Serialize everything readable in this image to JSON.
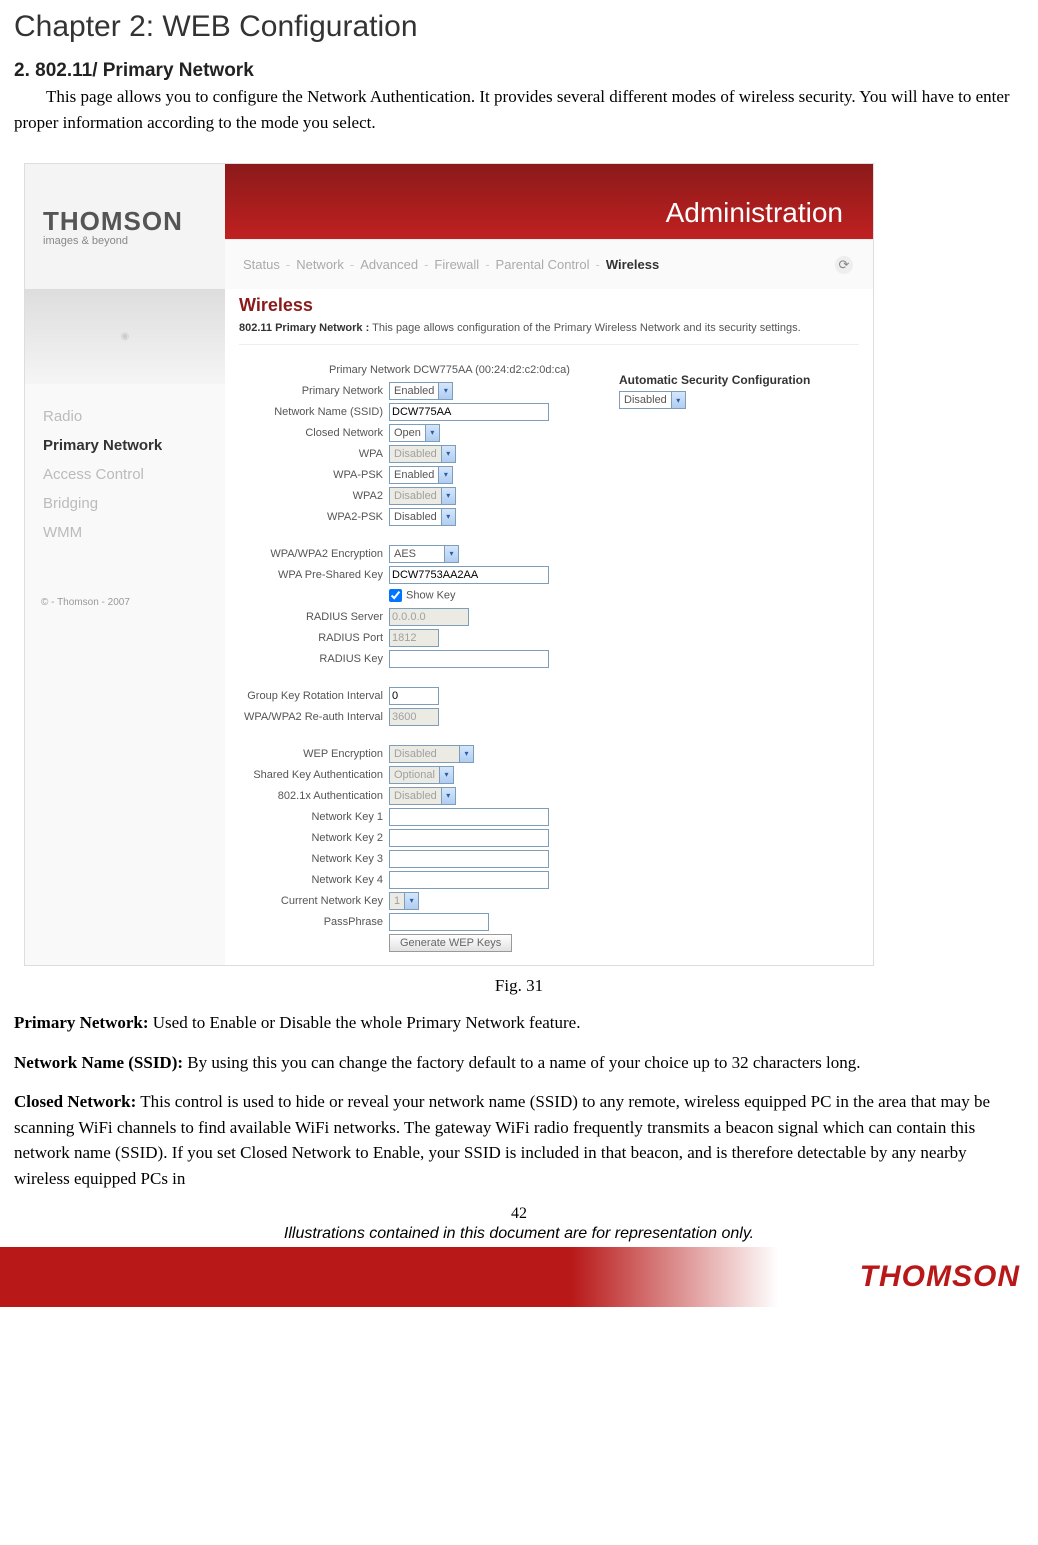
{
  "chapter_title": "Chapter 2: WEB Configuration",
  "section_title": "2. 802.11/ Primary Network",
  "intro_text": "This page allows you to configure the Network Authentication. It provides several different modes of wireless security. You will have to enter proper information according to the mode you select.",
  "fig_caption": "Fig. 31",
  "page_number": "42",
  "illustration_note": "Illustrations contained in this document are for representation only.",
  "footer_logo": "THOMSON",
  "screenshot": {
    "logo_text": "THOMSON",
    "logo_sub": "images & beyond",
    "admin_title": "Administration",
    "menu": [
      "Status",
      "Network",
      "Advanced",
      "Firewall",
      "Parental Control",
      "Wireless"
    ],
    "menu_active_index": 5,
    "sidebar_items": [
      "Radio",
      "Primary Network",
      "Access Control",
      "Bridging",
      "WMM"
    ],
    "sidebar_active_index": 1,
    "sidebar_footer": "© - Thomson - 2007",
    "heading": "Wireless",
    "subheading_bold": "802.11 Primary Network  :",
    "subheading_text": "  This page allows configuration of the Primary Wireless Network and its security settings.",
    "autosec_title": "Automatic Security Configuration",
    "autosec_value": "Disabled",
    "fields": {
      "primary_network_header": "Primary Network DCW775AA (00:24:d2:c2:0d:ca)",
      "primary_network_label": "Primary Network",
      "primary_network_value": "Enabled",
      "ssid_label": "Network Name (SSID)",
      "ssid_value": "DCW775AA",
      "closed_label": "Closed Network",
      "closed_value": "Open",
      "wpa_label": "WPA",
      "wpa_value": "Disabled",
      "wpapsk_label": "WPA-PSK",
      "wpapsk_value": "Enabled",
      "wpa2_label": "WPA2",
      "wpa2_value": "Disabled",
      "wpa2psk_label": "WPA2-PSK",
      "wpa2psk_value": "Disabled",
      "enc_label": "WPA/WPA2 Encryption",
      "enc_value": "AES",
      "psk_label": "WPA Pre-Shared Key",
      "psk_value": "DCW7753AA2AA",
      "showkey_label": "Show Key",
      "radius_server_label": "RADIUS Server",
      "radius_server_value": "0.0.0.0",
      "radius_port_label": "RADIUS Port",
      "radius_port_value": "1812",
      "radius_key_label": "RADIUS Key",
      "radius_key_value": "",
      "group_key_label": "Group Key Rotation Interval",
      "group_key_value": "0",
      "reauth_label": "WPA/WPA2 Re-auth Interval",
      "reauth_value": "3600",
      "wep_label": "WEP Encryption",
      "wep_value": "Disabled",
      "shared_label": "Shared Key Authentication",
      "shared_value": "Optional",
      "dot1x_label": "802.1x Authentication",
      "dot1x_value": "Disabled",
      "nk1_label": "Network Key 1",
      "nk2_label": "Network Key 2",
      "nk3_label": "Network Key 3",
      "nk4_label": "Network Key 4",
      "curkey_label": "Current Network Key",
      "curkey_value": "1",
      "pass_label": "PassPhrase",
      "pass_value": "",
      "genbtn": "Generate WEP Keys"
    }
  },
  "descriptions": [
    {
      "bold": "Primary Network:",
      "text": " Used to Enable or Disable the whole Primary Network feature."
    },
    {
      "bold": "Network Name (SSID):",
      "text": " By using this you can change the factory default to a name of your choice up to 32 characters long."
    },
    {
      "bold": "Closed Network:",
      "text": " This control is used to hide or reveal your network name (SSID) to any remote, wireless equipped PC in the area that may be scanning WiFi channels to find available WiFi networks. The gateway WiFi radio frequently transmits a beacon signal which can contain this network name (SSID). If you set Closed Network to Enable, your SSID is included in that beacon, and is therefore detectable by any nearby wireless equipped PCs in"
    }
  ]
}
